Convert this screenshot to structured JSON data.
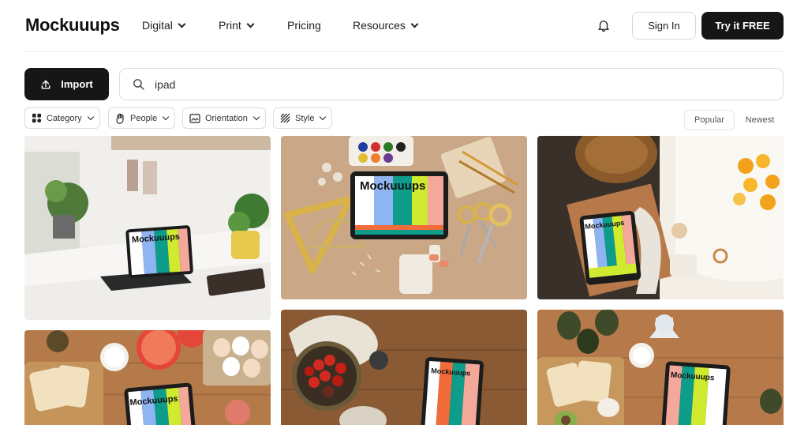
{
  "header": {
    "logo": "Mockuuups",
    "nav": [
      {
        "label": "Digital",
        "has_dropdown": true
      },
      {
        "label": "Print",
        "has_dropdown": true
      },
      {
        "label": "Pricing",
        "has_dropdown": false
      },
      {
        "label": "Resources",
        "has_dropdown": true
      }
    ],
    "signin_label": "Sign In",
    "try_label": "Try it FREE",
    "notification_icon": "bell-icon"
  },
  "toolbar": {
    "import_label": "Import",
    "search_value": "ipad",
    "search_placeholder": "",
    "filters": [
      {
        "label": "Category",
        "icon": "grid-icon"
      },
      {
        "label": "People",
        "icon": "hand-icon"
      },
      {
        "label": "Orientation",
        "icon": "image-frame-icon"
      },
      {
        "label": "Style",
        "icon": "hatch-icon"
      }
    ],
    "sort": [
      {
        "label": "Popular",
        "active": true
      },
      {
        "label": "Newest",
        "active": false
      }
    ]
  },
  "gallery": {
    "mockup_brand": "Mockuuups",
    "items": [
      {
        "scene": "white desk with ipad and keyboard, plants"
      },
      {
        "scene": "flat lay with ipad, stationery, scissors, ruler"
      },
      {
        "scene": "bathtub scene with ipad, basket, orange slices"
      },
      {
        "scene": "breakfast table with ipad, grapefruit, eggs"
      },
      {
        "scene": "wooden table with ipad, tomatoes, cloth"
      },
      {
        "scene": "wooden table with ipad, avocados, bread"
      }
    ]
  },
  "colors": {
    "accent_dark": "#161616",
    "border": "#dcdcdc",
    "screen_stripes": [
      "#ffffff",
      "#8fb4f2",
      "#0e9c8b",
      "#cfea2f",
      "#f3a89a"
    ]
  }
}
